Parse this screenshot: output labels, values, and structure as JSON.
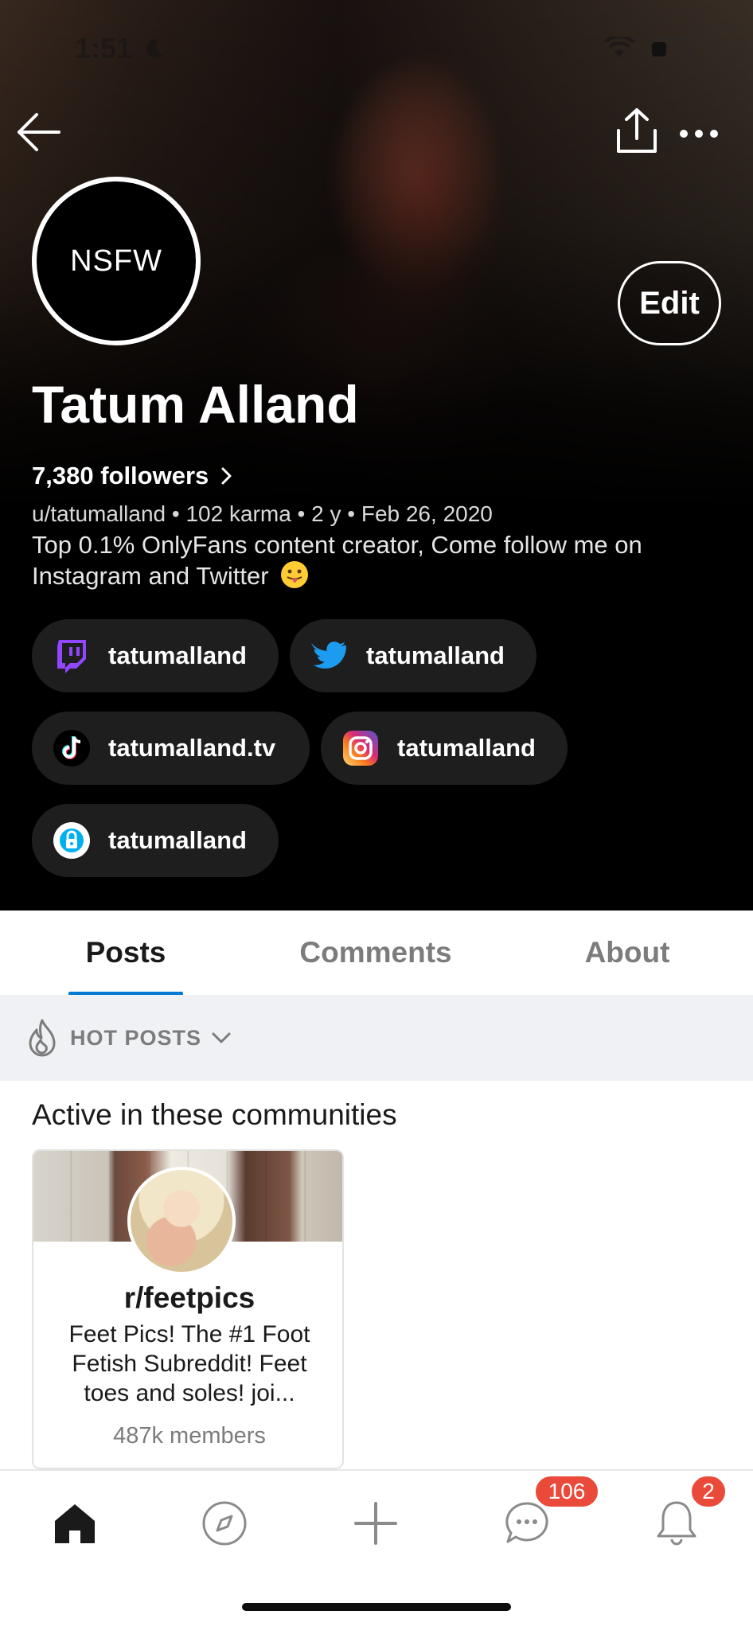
{
  "status_bar": {
    "time": "1:51"
  },
  "profile": {
    "avatar_text": "NSFW",
    "display_name": "Tatum Alland",
    "followers_label": "7,380 followers",
    "meta": "u/tatumalland • 102 karma • 2 y • Feb 26, 2020",
    "bio": "Top 0.1% OnlyFans content creator,  Come follow me on Instagram and Twitter",
    "edit_label": "Edit"
  },
  "social_links": [
    {
      "platform": "twitch",
      "icon": "twitch-icon",
      "label": "tatumalland",
      "color": "#9146ff"
    },
    {
      "platform": "twitter",
      "icon": "twitter-icon",
      "label": "tatumalland",
      "color": "#1d9bf0"
    },
    {
      "platform": "tiktok",
      "icon": "tiktok-icon",
      "label": "tatumalland.tv",
      "color": "#000000"
    },
    {
      "platform": "instagram",
      "icon": "instagram-icon",
      "label": "tatumalland",
      "color": "#e1306c"
    },
    {
      "platform": "onlyfans",
      "icon": "onlyfans-icon",
      "label": "tatumalland",
      "color": "#00aff0"
    }
  ],
  "tabs": [
    {
      "label": "Posts",
      "active": true
    },
    {
      "label": "Comments",
      "active": false
    },
    {
      "label": "About",
      "active": false
    }
  ],
  "sort": {
    "label": "HOT POSTS"
  },
  "communities": {
    "title": "Active in these communities",
    "items": [
      {
        "name": "r/feetpics",
        "description": "Feet Pics! The #1 Foot Fetish Subreddit! Feet toes and soles!        joi...",
        "members": "487k members"
      }
    ]
  },
  "bottom_nav": {
    "items": [
      "home-icon",
      "discover-icon",
      "create-icon",
      "chat-icon",
      "inbox-icon"
    ],
    "chat_badge": "106",
    "inbox_badge": "2"
  },
  "colors": {
    "accent": "#0079d3",
    "badge": "#ea4a3a",
    "chip_bg": "#1e1e1e"
  }
}
